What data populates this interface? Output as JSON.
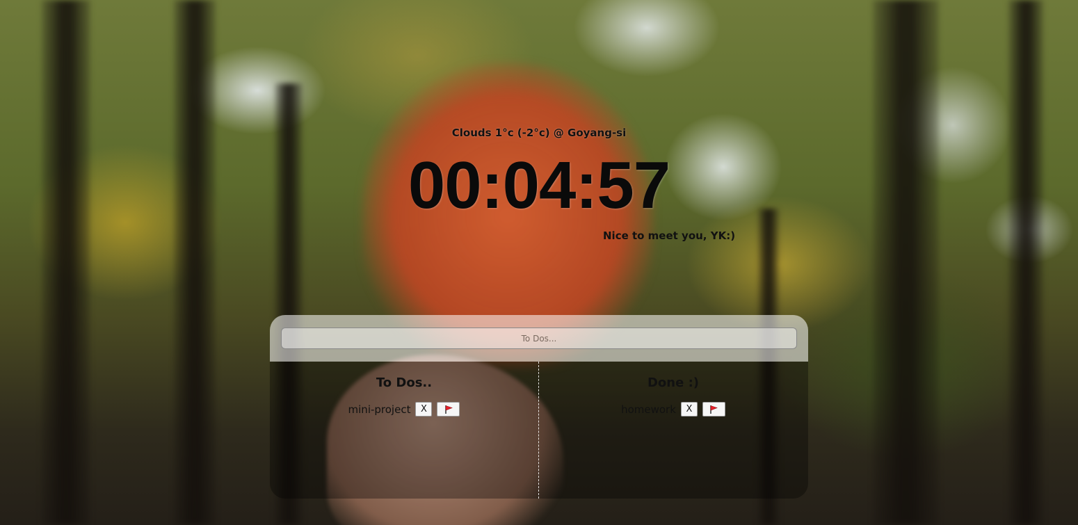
{
  "weather": {
    "text": "Clouds 1°c (-2°c) @ Goyang-si"
  },
  "clock": {
    "time": "00:04:57"
  },
  "greeting": {
    "text": "Nice to meet you, YK:)"
  },
  "todo_input": {
    "placeholder": "To Dos..."
  },
  "todo_column": {
    "title": "To Dos..",
    "items": [
      {
        "text": "mini-project",
        "delete_label": "X",
        "flag_icon": "red-flag"
      }
    ]
  },
  "done_column": {
    "title": "Done :)",
    "items": [
      {
        "text": "homework",
        "delete_label": "X",
        "flag_icon": "red-flag"
      }
    ]
  },
  "colors": {
    "flag": "#e8202a",
    "panel_top": "rgba(255,255,255,0.55)",
    "panel_bottom": "rgba(0,0,0,0.32)"
  }
}
